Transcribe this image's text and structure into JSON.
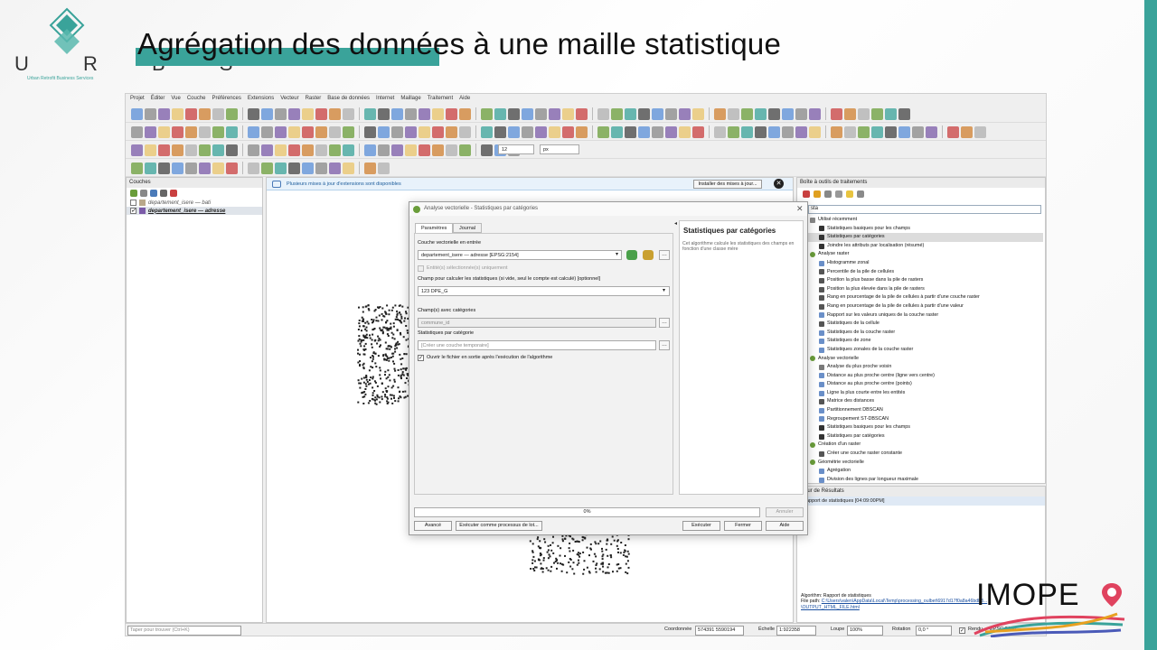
{
  "slide": {
    "title": "Agrégation des données à une maille statistique",
    "logo_letters": "U R B S",
    "logo_sub": "Urban Retrofit Business Services",
    "partner_logo": "IMOPE"
  },
  "qgis": {
    "menu": [
      "Projet",
      "Éditer",
      "Vue",
      "Couche",
      "Préférences",
      "Extensions",
      "Vecteur",
      "Raster",
      "Base de données",
      "Internet",
      "Maillage",
      "Traitement",
      "Aide"
    ],
    "snap_value": "12",
    "snap_unit": "px",
    "layers_title": "Couches",
    "layers": [
      {
        "name": "departement_isere — bati",
        "checked": false
      },
      {
        "name": "departement_isere — adresse",
        "checked": true
      }
    ],
    "message": "Plusieurs mises à jour d'extensions sont disponibles",
    "install_label": "Installer des mises à jour...",
    "toolbox_title": "Boîte à outils de traitements",
    "toolbox_search": "sta",
    "tree": [
      {
        "t": "g",
        "label": "Utilisé récemment",
        "icon": "clock-icon"
      },
      {
        "t": "i",
        "label": "Statistiques basiques pour les champs",
        "icon": "sigma-icon"
      },
      {
        "t": "i",
        "label": "Statistiques par catégories",
        "icon": "sigma-icon",
        "sel": true
      },
      {
        "t": "i",
        "label": "Joindre les attributs par localisation (résumé)",
        "icon": "sigma-icon"
      },
      {
        "t": "g",
        "label": "Analyse raster",
        "icon": "qgis-icon"
      },
      {
        "t": "i",
        "label": "Histogramme zonal",
        "icon": "gear-icon"
      },
      {
        "t": "i",
        "label": "Percentile de la pile de cellules",
        "icon": "raster-icon"
      },
      {
        "t": "i",
        "label": "Position la plus basse dans la pile de rasters",
        "icon": "raster-icon"
      },
      {
        "t": "i",
        "label": "Position la plus élevée dans la pile de rasters",
        "icon": "raster-icon"
      },
      {
        "t": "i",
        "label": "Rang en pourcentage de la pile de cellules à partir d'une couche raster",
        "icon": "raster-icon"
      },
      {
        "t": "i",
        "label": "Rang en pourcentage de la pile de cellules à partir d'une valeur",
        "icon": "raster-icon"
      },
      {
        "t": "i",
        "label": "Rapport sur les valeurs uniques de la couche raster",
        "icon": "gear-icon"
      },
      {
        "t": "i",
        "label": "Statistiques de la cellule",
        "icon": "raster-icon"
      },
      {
        "t": "i",
        "label": "Statistiques de la couche raster",
        "icon": "gear-icon"
      },
      {
        "t": "i",
        "label": "Statistiques de zone",
        "icon": "gear-icon"
      },
      {
        "t": "i",
        "label": "Statistiques zonales de la couche raster",
        "icon": "gear-icon"
      },
      {
        "t": "g",
        "label": "Analyse vectorielle",
        "icon": "qgis-icon"
      },
      {
        "t": "i",
        "label": "Analyse du plus proche voisin",
        "icon": "vector-icon"
      },
      {
        "t": "i",
        "label": "Distance au plus proche centre (ligne vers centre)",
        "icon": "gear-icon"
      },
      {
        "t": "i",
        "label": "Distance au plus proche centre (points)",
        "icon": "gear-icon"
      },
      {
        "t": "i",
        "label": "Ligne la plus courte entre les entités",
        "icon": "gear-icon"
      },
      {
        "t": "i",
        "label": "Matrice des distances",
        "icon": "raster-icon"
      },
      {
        "t": "i",
        "label": "Partitionnement DBSCAN",
        "icon": "gear-icon"
      },
      {
        "t": "i",
        "label": "Regroupement ST-DBSCAN",
        "icon": "gear-icon"
      },
      {
        "t": "i",
        "label": "Statistiques basiques pour les champs",
        "icon": "sigma-icon"
      },
      {
        "t": "i",
        "label": "Statistiques par catégories",
        "icon": "sigma-icon"
      },
      {
        "t": "g",
        "label": "Création d'un raster",
        "icon": "qgis-icon"
      },
      {
        "t": "i",
        "label": "Créer une couche raster constante",
        "icon": "raster-icon"
      },
      {
        "t": "g",
        "label": "Géométrie vectorielle",
        "icon": "qgis-icon"
      },
      {
        "t": "i",
        "label": "Agrégation",
        "icon": "gear-icon"
      },
      {
        "t": "i",
        "label": "Division des lignes par longueur maximale",
        "icon": "gear-icon"
      }
    ],
    "results_title": "ateur de Résultats",
    "result_item": "Rapport de statistiques [04:09:00PM]",
    "result_algo": "Algorithm: Rapport de statistiques",
    "result_path_label": "File path: ",
    "result_path": "C:\\Users\\valen\\AppData\\Local\\Temp\\processing_oulbet\\6917d17f0a8a46bdb8... \\OUTPUT_HTML_FILE.html",
    "status": {
      "search_placeholder": "Taper pour trouver (Ctrl+K)",
      "coord_label": "Coordonnée",
      "coord": "574391  5590194",
      "scale_label": "Échelle",
      "scale": "1:922358",
      "magnifier_label": "Loupe",
      "magnifier": "100%",
      "rotation_label": "Rotation",
      "rotation": "0,0 °",
      "render_label": "Rendu",
      "crs": "EPSG:2154"
    }
  },
  "dialog": {
    "title": "Analyse vectorielle - Statistiques par catégories",
    "tabs": [
      "Paramètres",
      "Journal"
    ],
    "input_label": "Couche vectorielle en entrée",
    "input_value": "departement_isere — adresse [EPSG:2154]",
    "selected_only": "Entité(s) sélectionnée(s) uniquement",
    "field_label": "Champ pour calculer les statistiques (si vide, seul le compte est calculé) [optionnel]",
    "field_value": "123 DPE_G",
    "cat_label": "Champ(s) avec catégories",
    "cat_value": "commune_id",
    "out_label": "Statistiques par catégorie",
    "out_placeholder": "[Créer une couche temporaire]",
    "open_label": "Ouvrir le fichier en sortie après l'exécution de l'algorithme",
    "help_title": "Statistiques par catégories",
    "help_text": "Cet algorithme calcule les statistiques des champs en fonction d'une classe mère",
    "progress": "0%",
    "progress_fraction": 0,
    "buttons": {
      "cancel": "Annuler",
      "advanced": "Avancé",
      "batch": "Exécuter comme processus de lot...",
      "run": "Exécuter",
      "close": "Fermer",
      "help": "Aide"
    }
  }
}
